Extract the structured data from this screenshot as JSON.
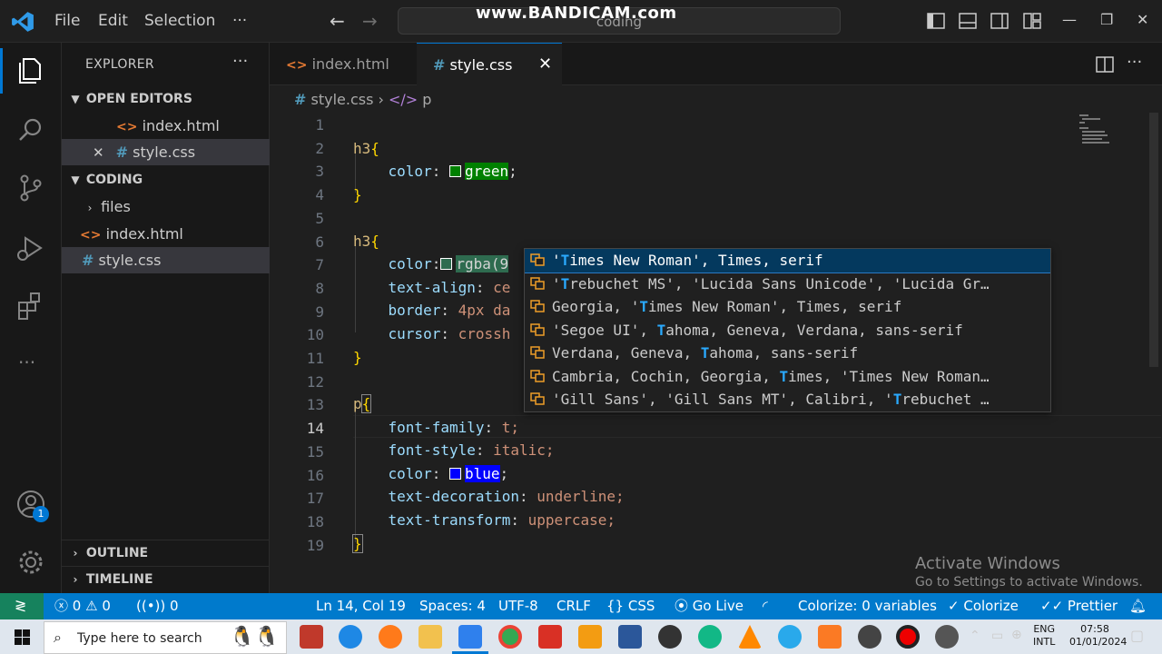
{
  "title_bar": {
    "menu": [
      "File",
      "Edit",
      "Selection",
      "···"
    ],
    "search_text": "coding",
    "watermark": "www.BANDICAM.com"
  },
  "sidebar": {
    "title": "EXPLORER",
    "more": "···",
    "open_editors_label": "OPEN EDITORS",
    "open_editors": [
      {
        "name": "index.html",
        "type": "html"
      },
      {
        "name": "style.css",
        "type": "css"
      }
    ],
    "folder_label": "CODING",
    "folder_items": [
      {
        "name": "files",
        "type": "folder"
      },
      {
        "name": "index.html",
        "type": "html"
      },
      {
        "name": "style.css",
        "type": "css"
      }
    ],
    "outline_label": "OUTLINE",
    "timeline_label": "TIMELINE"
  },
  "tabs": [
    {
      "label": "index.html",
      "active": false
    },
    {
      "label": "style.css",
      "active": true
    }
  ],
  "breadcrumb": {
    "file": "style.css",
    "symbol": "p"
  },
  "editor": {
    "current_line": 14,
    "line_numbers": [
      "1",
      "2",
      "3",
      "4",
      "5",
      "6",
      "7",
      "8",
      "9",
      "10",
      "11",
      "12",
      "13",
      "14",
      "15",
      "16",
      "17",
      "18",
      "19"
    ],
    "lines": {
      "l2_sel": "h3",
      "l2_brace": "{",
      "l3_prop": "color",
      "l3_val": "green",
      "l3_end": ";",
      "l4": "}",
      "l6_sel": "h3",
      "l6_brace": "{",
      "l7_prop": "color",
      "l7_val": "rgba(9",
      "l8_prop": "text-align",
      "l8_val": "ce",
      "l9_prop": "border",
      "l9_val": "4px da",
      "l10_prop": "cursor",
      "l10_val": "crossh",
      "l11": "}",
      "l13_sel": "p",
      "l13_brace": "{",
      "l14_prop": "font-family",
      "l14_val": "t;",
      "l15_prop": "font-style",
      "l15_val": "italic;",
      "l16_prop": "color",
      "l16_val": "blue",
      "l16_end": ";",
      "l17_prop": "text-decoration",
      "l17_val": "underline;",
      "l18_prop": "text-transform",
      "l18_val": "uppercase;",
      "l19": "}"
    }
  },
  "suggestions": [
    {
      "pre": "'",
      "match": "T",
      "rest": "imes New Roman', Times, serif"
    },
    {
      "pre": "'",
      "match": "T",
      "rest": "rebuchet MS', 'Lucida Sans Unicode', 'Lucida Gr…"
    },
    {
      "pre": "Georgia, '",
      "match": "T",
      "rest": "imes New Roman', Times, serif"
    },
    {
      "pre": "'Segoe UI', ",
      "match": "T",
      "rest": "ahoma, Geneva, Verdana, sans-serif"
    },
    {
      "pre": "Verdana, Geneva, ",
      "match": "T",
      "rest": "ahoma, sans-serif"
    },
    {
      "pre": "Cambria, Cochin, Georgia, ",
      "match": "T",
      "rest": "imes, 'Times New Roman…"
    },
    {
      "pre": "'Gill Sans', 'Gill Sans MT', Calibri, '",
      "match": "T",
      "rest": "rebuchet …"
    }
  ],
  "activate_windows": {
    "line1": "Activate Windows",
    "line2": "Go to Settings to activate Windows."
  },
  "status_bar": {
    "errors": "0",
    "warnings": "0",
    "ports": "0",
    "position": "Ln 14, Col 19",
    "spaces": "Spaces: 4",
    "encoding": "UTF-8",
    "eol": "CRLF",
    "language": "CSS",
    "go_live": "Go Live",
    "colorize_vars": "Colorize: 0 variables",
    "colorize": "Colorize",
    "prettier": "Prettier"
  },
  "account_badge": "1",
  "taskbar": {
    "search_placeholder": "Type here to search",
    "lang_1": "ENG",
    "lang_2": "INTL",
    "time": "07:58",
    "date": "01/01/2024"
  },
  "colors": {
    "accent": "#007acc",
    "remote": "#16825d",
    "selection": "#04395e"
  }
}
